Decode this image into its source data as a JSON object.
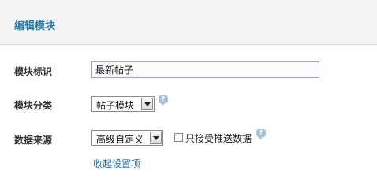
{
  "header": {
    "title": "编辑模块"
  },
  "form": {
    "module_id": {
      "label": "模块标识",
      "value": "最新帖子"
    },
    "module_category": {
      "label": "模块分类",
      "selected": "帖子模块",
      "help_icon": "help-bubble-icon"
    },
    "data_source": {
      "label": "数据来源",
      "selected": "高级自定义",
      "checkbox_label": "只接受推送数据",
      "checkbox_checked": false,
      "help_icon": "help-bubble-icon"
    },
    "collapse_link": "收起设置项"
  },
  "colors": {
    "title": "#2a7aa7",
    "link": "#2a6fa8",
    "help_icon": "#a9bfd6"
  }
}
